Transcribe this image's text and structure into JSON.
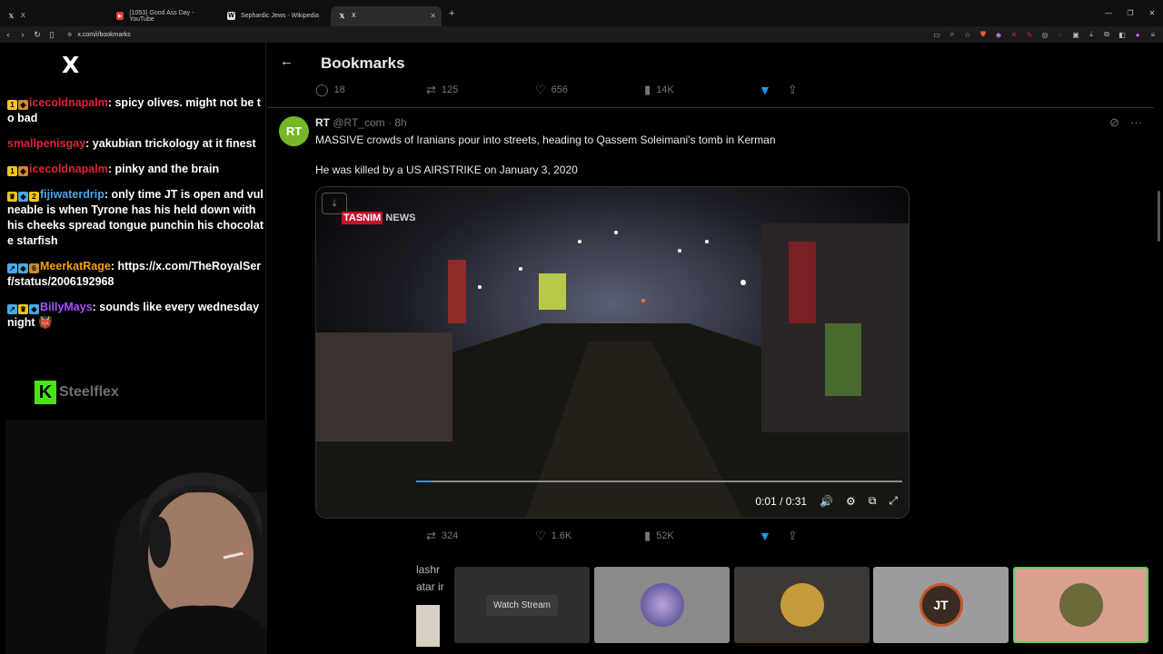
{
  "browser": {
    "tabs": [
      {
        "label": "X",
        "favicon": "X",
        "active": false
      },
      {
        "label": "(1053) Good Ass Day - YouTube",
        "favicon": "youtube-icon",
        "active": false
      },
      {
        "label": "Sephardic Jews - Wikipedia",
        "favicon": "W",
        "active": false
      },
      {
        "label": "X",
        "favicon": "X",
        "active": true
      }
    ],
    "url": "x.com/i/bookmarks"
  },
  "chat": {
    "logo": "X",
    "messages": [
      {
        "user": "icecoldnapalm",
        "color": "#e0213c",
        "text": ": spicy olives. might not be to bad"
      },
      {
        "user": "smallpenisgay",
        "color": "#e0213c",
        "text": ": yakubian trickology at it finest"
      },
      {
        "user": "icecoldnapalm",
        "color": "#e0213c",
        "text": ": pinky and the brain"
      },
      {
        "user": "fijiwaterdrip",
        "color": "#4aa8e8",
        "text": ": only time JT is open and vulneable is when Tyrone has his held down with his cheeks spread tongue punchin his chocolate starfish"
      },
      {
        "user": "MeerkatRage",
        "color": "#f2a20c",
        "text": ": https://x.com/TheRoyalSerf/status/2006192968"
      },
      {
        "user": "BillyMays",
        "color": "#a855f7",
        "text": ": sounds like every wednesday night 👹"
      }
    ],
    "watermark": "Steelflex"
  },
  "main": {
    "title": "Bookmarks",
    "prev_actions": {
      "replies": "18",
      "reposts": "125",
      "likes": "656",
      "views": "14K"
    },
    "tweet": {
      "avatar_text": "RT",
      "name": "RT",
      "handle": "@RT_com · 8h",
      "line1": "MASSIVE crowds of Iranians pour into streets, heading to Qassem Soleimani's tomb in Kerman",
      "line2": "He was killed by a US AIRSTRIKE on January 3, 2020",
      "video": {
        "brand_red": "TASNIM",
        "brand_grey": "NEWS",
        "time": "0:01 / 0:31",
        "progress": 0.03
      },
      "actions": {
        "reposts": "324",
        "likes": "1.6K",
        "views": "52K"
      }
    }
  },
  "bottom": {
    "partial1": "lashr",
    "partial2": "atar ir",
    "watch_label": "Watch Stream",
    "card_colors": [
      "#2e2e30",
      "#8a8a8a",
      "#3d3834",
      "#9c9c9c",
      "#d9a090"
    ],
    "jt_label": "JT"
  }
}
